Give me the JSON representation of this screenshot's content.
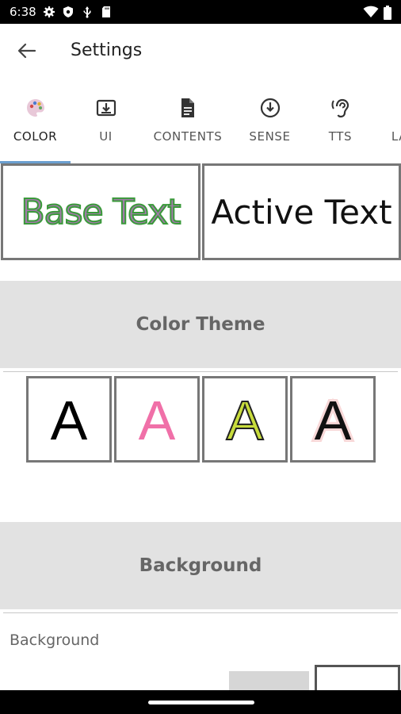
{
  "status_bar": {
    "time": "6:38",
    "icons_left": [
      "gear-icon",
      "shield-icon",
      "usb-icon",
      "sd-card-icon"
    ],
    "icons_right": [
      "wifi-icon",
      "battery-icon"
    ]
  },
  "app_bar": {
    "back_icon": "arrow-left-icon",
    "title": "Settings"
  },
  "tabs": [
    {
      "label": "COLOR",
      "icon": "palette-icon",
      "active": true
    },
    {
      "label": "UI",
      "icon": "download-box-icon",
      "active": false
    },
    {
      "label": "CONTENTS",
      "icon": "document-icon",
      "active": false
    },
    {
      "label": "SENSE",
      "icon": "download-circle-icon",
      "active": false
    },
    {
      "label": "TTS",
      "icon": "ear-icon",
      "active": false
    },
    {
      "label": "LA",
      "icon": "",
      "active": false
    }
  ],
  "preview": {
    "base_text": "Base Text",
    "active_text": "Active Text"
  },
  "color_theme": {
    "header": "Color Theme",
    "options": [
      {
        "glyph": "A",
        "fill": "#000000",
        "stroke": "none"
      },
      {
        "glyph": "A",
        "fill": "#f070a8",
        "stroke": "none"
      },
      {
        "glyph": "A",
        "fill": "#c8dc3c",
        "stroke": "#222222"
      },
      {
        "glyph": "A",
        "fill": "#111111",
        "stroke": "#f8d8d8"
      }
    ]
  },
  "background": {
    "header": "Background",
    "label": "Background"
  },
  "colors": {
    "tab_indicator": "#6b9fd0",
    "section_header_bg": "#e2e2e2",
    "base_text_fill": "#a07aa8",
    "base_text_stroke": "#3a9a3a"
  }
}
